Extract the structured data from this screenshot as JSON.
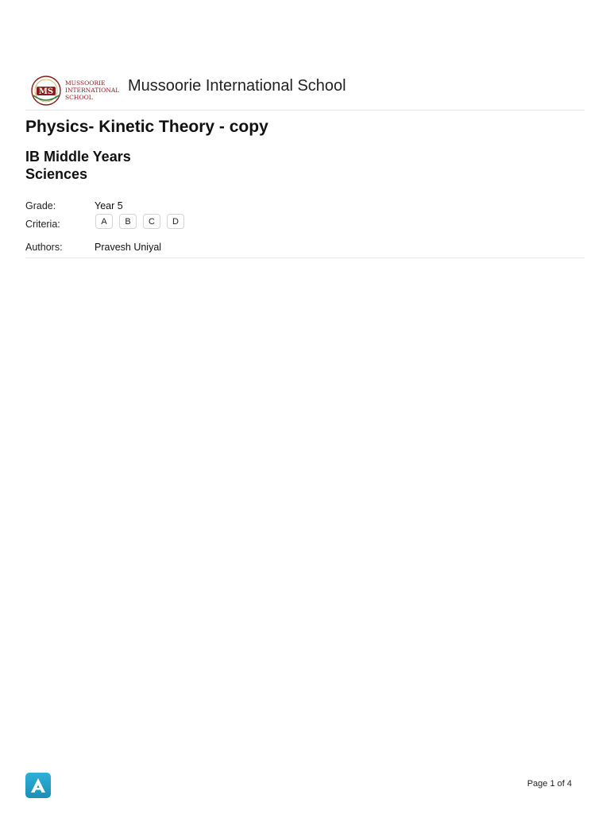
{
  "header": {
    "logo_lines": [
      "MUSSOORIE",
      "INTERNATIONAL",
      "SCHOOL"
    ],
    "logo_monogram": "MS",
    "school_name": "Mussoorie International School",
    "brand_color": "#8b1a1a"
  },
  "document": {
    "title": "Physics- Kinetic Theory - copy",
    "programme_line1": "IB Middle Years",
    "programme_line2": "Sciences"
  },
  "meta": {
    "grade_label": "Grade:",
    "grade_value": "Year 5",
    "criteria_label": "Criteria:",
    "criteria": [
      "A",
      "B",
      "C",
      "D"
    ],
    "authors_label": "Authors:",
    "authors_value": "Pravesh Uniyal"
  },
  "footer": {
    "app_icon": "a-logo-icon",
    "app_icon_color": "#2aa8d2",
    "page_label": "Page 1 of 4"
  }
}
